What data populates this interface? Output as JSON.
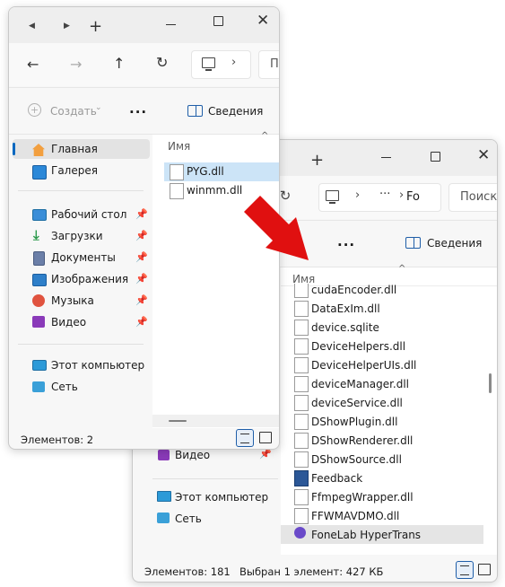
{
  "back_window": {
    "tab_add": "+",
    "address_part": "Fo",
    "search_placeholder": "Поиск",
    "toolbar": {
      "more": "...",
      "details": "Сведения"
    },
    "col_name": "Имя",
    "files": [
      "cudaEncoder.dll",
      "DataExIm.dll",
      "device.sqlite",
      "DeviceHelpers.dll",
      "DeviceHelperUIs.dll",
      "deviceManager.dll",
      "deviceService.dll",
      "DShowPlugin.dll",
      "DShowRenderer.dll",
      "DShowSource.dll",
      "Feedback",
      "FfmpegWrapper.dll",
      "FFWMAVDMO.dll",
      "FoneLab HyperTrans"
    ],
    "sidebar": {
      "video": "Видео",
      "this_pc": "Этот компьютер",
      "network": "Сеть"
    },
    "status": {
      "count": "Элементов: 181",
      "selected": "Выбран 1 элемент: 427 КБ"
    }
  },
  "front_window": {
    "tab_add": "+",
    "address_part": "П",
    "toolbar": {
      "create": "Создать",
      "more": "...",
      "details": "Сведения"
    },
    "col_name": "Имя",
    "files": [
      "PYG.dll",
      "winmm.dll"
    ],
    "sidebar": {
      "home": "Главная",
      "gallery": "Галерея",
      "desktop": "Рабочий стол",
      "downloads": "Загрузки",
      "documents": "Документы",
      "pictures": "Изображения",
      "music": "Музыка",
      "video": "Видео",
      "this_pc": "Этот компьютер",
      "network": "Сеть"
    },
    "status": {
      "count": "Элементов: 2"
    }
  },
  "colors": {
    "accent": "#0067c0",
    "arrow": "#e01010",
    "selection": "#cce4f7"
  }
}
